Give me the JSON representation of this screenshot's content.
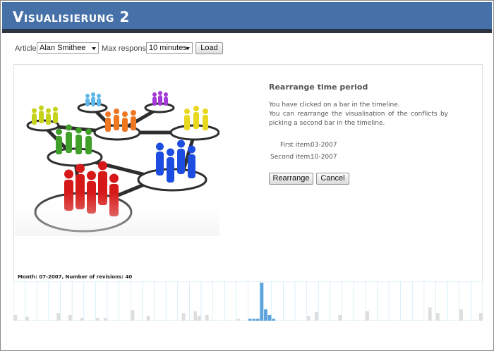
{
  "header": {
    "title": "Visualisierung 2"
  },
  "controls": {
    "article_label": "Article:",
    "article_value": "Alan Smithee",
    "max_response_label": "Max response:",
    "max_response_value": "10 minutes",
    "load_label": "Load"
  },
  "dialog": {
    "title": "Rearrange time period",
    "line1": "You have clicked on a bar in the timeline.",
    "line2": "You can rearrange the visualisation of the conflicts by picking a second bar in the timeline.",
    "first_label": "First item:",
    "first_value": "03-2007",
    "second_label": "Second item:",
    "second_value": "10-2007",
    "rearrange_label": "Rearrange",
    "cancel_label": "Cancel"
  },
  "status": {
    "text": "Month: 07-2007, Number of revisions: 40"
  },
  "colors": {
    "header": "#4670a8",
    "header_bar": "#2c3442",
    "bar_default": "#dddddd",
    "bar_selected": "#5ba3dc",
    "gridline": "#cdeaf6",
    "people": [
      "#c6d31c",
      "#5fb6e8",
      "#a33ad8",
      "#ee7722",
      "#40a02a",
      "#e8d820",
      "#1c4ce0",
      "#d61818"
    ]
  },
  "illustration": {
    "icon": "people-network-illustration"
  },
  "timeline": {
    "type": "bar",
    "selected_index": 63,
    "highlight_range": [
      60,
      66
    ],
    "values": [
      6,
      0,
      0,
      4,
      0,
      0,
      0,
      0,
      0,
      0,
      0,
      8,
      0,
      0,
      6,
      0,
      0,
      3,
      0,
      0,
      0,
      3,
      0,
      3,
      0,
      0,
      0,
      0,
      0,
      0,
      11,
      0,
      0,
      0,
      5,
      0,
      0,
      0,
      0,
      0,
      0,
      0,
      0,
      8,
      0,
      0,
      10,
      5,
      0,
      6,
      0,
      0,
      0,
      0,
      0,
      0,
      0,
      2,
      0,
      0,
      2,
      2,
      2,
      40,
      12,
      6,
      2,
      0,
      0,
      0,
      0,
      0,
      0,
      0,
      0,
      5,
      0,
      9,
      0,
      0,
      0,
      0,
      0,
      6,
      0,
      0,
      0,
      0,
      0,
      0,
      10,
      0,
      0,
      0,
      0,
      0,
      0,
      0,
      0,
      0,
      0,
      0,
      0,
      0,
      0,
      0,
      14,
      0,
      8,
      0,
      0,
      0,
      0,
      0,
      12,
      0,
      0,
      0,
      0,
      8
    ]
  }
}
